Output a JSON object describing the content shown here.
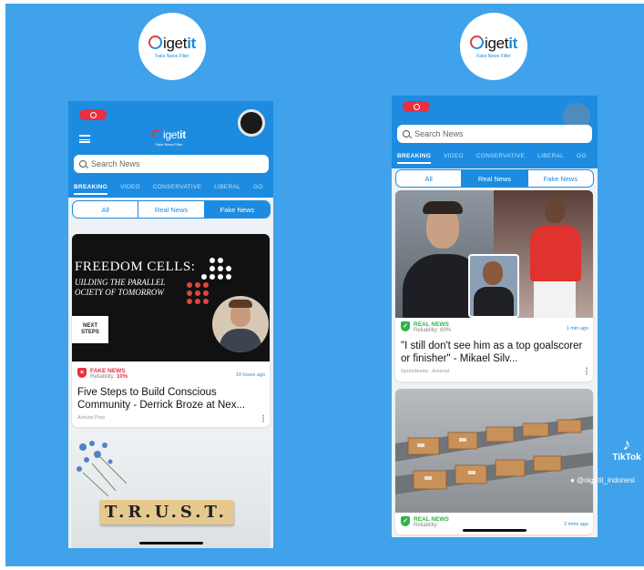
{
  "brand": {
    "name_prefix": "",
    "name_get": "get",
    "name_it": "it",
    "name_i": "i",
    "tagline": "Fake News Filter"
  },
  "colors": {
    "background": "#3fa2ea",
    "accent": "#1d8ce0",
    "fake": "#e8303f",
    "real": "#2fb24a"
  },
  "left_phone": {
    "status_time": "",
    "search_placeholder": "Search News",
    "categories": [
      "BREAKING",
      "VIDEO",
      "CONSERVATIVE",
      "LIBERAL",
      "GO"
    ],
    "filters": [
      "All",
      "Real News",
      "Fake News"
    ],
    "selected_filter": "Fake News",
    "cards": [
      {
        "image": "Freedom Cells conference banner",
        "image_title": "FREEDOM CELLS:",
        "image_subtitle_1": "UILDING THE PARALLEL",
        "image_subtitle_2": "OCIETY OF TOMORROW",
        "image_brand": "NEXT STEPS",
        "badge": "FAKE NEWS",
        "reliability_label": "Reliability:",
        "reliability_value": "10%",
        "time": "10 hours ago",
        "headline": "Five Steps to Build Conscious Community - Derrick Broze at Nex...",
        "source": "Activist Post"
      },
      {
        "image": "TRUST letter tiles",
        "image_word": "T.R.U.S.T."
      }
    ]
  },
  "right_phone": {
    "search_placeholder": "Search News",
    "categories": [
      "BREAKING",
      "VIDEO",
      "CONSERVATIVE",
      "LIBERAL",
      "GO"
    ],
    "filters": [
      "All",
      "Real News",
      "Fake News"
    ],
    "selected_filter": "Real News",
    "cards": [
      {
        "image": "Football managers and players",
        "badge": "REAL NEWS",
        "reliability_label": "Reliability:",
        "reliability_value": "69%",
        "time": "1 min ago",
        "headline": "\"I still don't see him as a top goalscorer or finisher\" - Mikael Silv...",
        "source": "Sportsfeeda · Arsenal"
      },
      {
        "image": "Packages on conveyor belts",
        "badge": "REAL NEWS",
        "reliability_label": "Reliability:",
        "reliability_value": "",
        "time": "2 mins ago"
      }
    ]
  },
  "watermark": {
    "app": "TikTok",
    "handle": "@oigetit_indonesi"
  }
}
